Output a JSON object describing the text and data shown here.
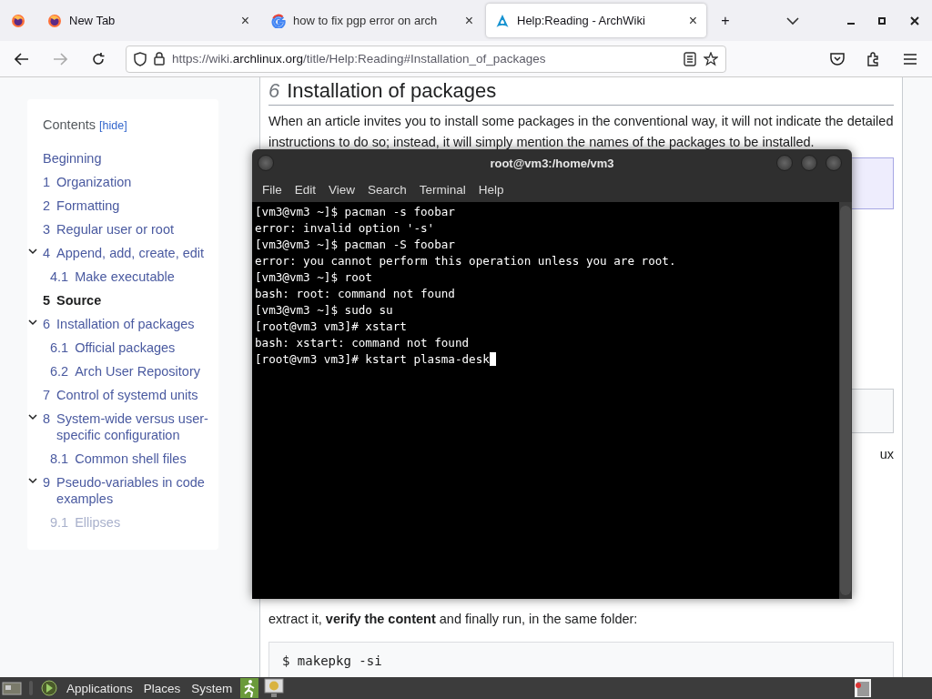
{
  "browser": {
    "tabs": [
      {
        "kind": "pinned",
        "selected": false
      },
      {
        "kind": "page",
        "label": "New Tab",
        "close": "×",
        "selected": false
      },
      {
        "kind": "page",
        "label": "how to fix pgp error on arch",
        "close": "×",
        "selected": false
      },
      {
        "kind": "page",
        "label": "Help:Reading - ArchWiki",
        "close": "×",
        "selected": true
      }
    ],
    "new_tab": "+",
    "url": {
      "scheme": "https://wiki.",
      "domain": "archlinux.org",
      "path": "/title/Help:Reading#Installation_of_packages"
    }
  },
  "toc": {
    "title": "Contents",
    "toggle": "[hide]",
    "items": [
      {
        "label": "Beginning",
        "selected": false
      },
      {
        "number": "1",
        "label": "Organization",
        "selected": false
      },
      {
        "number": "2",
        "label": "Formatting",
        "selected": false
      },
      {
        "number": "3",
        "label": "Regular user or root",
        "selected": false
      },
      {
        "number": "4",
        "label": "Append, add, create, edit",
        "selected": false,
        "expanded": true,
        "children": [
          {
            "number": "4.1",
            "label": "Make executable",
            "selected": false
          }
        ]
      },
      {
        "number": "5",
        "label": "Source",
        "selected": true
      },
      {
        "number": "6",
        "label": "Installation of packages",
        "selected": false,
        "expanded": true,
        "children": [
          {
            "number": "6.1",
            "label": "Official packages",
            "selected": false
          },
          {
            "number": "6.2",
            "label": "Arch User Repository",
            "selected": false
          }
        ]
      },
      {
        "number": "7",
        "label": "Control of systemd units",
        "selected": false
      },
      {
        "number": "8",
        "label": "System-wide versus user-specific configuration",
        "selected": false,
        "expanded": true,
        "children": [
          {
            "number": "8.1",
            "label": "Common shell files",
            "selected": false
          }
        ]
      },
      {
        "number": "9",
        "label": "Pseudo-variables in code examples",
        "selected": false,
        "expanded": true,
        "children": [
          {
            "number": "9.1",
            "label": "Ellipses",
            "selected": false
          }
        ]
      }
    ]
  },
  "article": {
    "heading_number": "6",
    "heading": "Installation of packages",
    "intro": "When an article invites you to install some packages in the conventional way, it will not indicate the detailed instructions to do so; instead, it will simply mention the names of the packages to be installed.",
    "fragment": "ux",
    "after": "extract it, **verify the content** and finally run, in the same folder:",
    "code": "$ makepkg -si"
  },
  "terminal": {
    "title": "root@vm3:/home/vm3",
    "menu": [
      "File",
      "Edit",
      "View",
      "Search",
      "Terminal",
      "Help"
    ],
    "lines": [
      "[vm3@vm3 ~]$ pacman -s foobar",
      "error: invalid option '-s'",
      "[vm3@vm3 ~]$ pacman -S foobar",
      "error: you cannot perform this operation unless you are root.",
      "[vm3@vm3 ~]$ root",
      "bash: root: command not found",
      "[vm3@vm3 ~]$ sudo su",
      "[root@vm3 vm3]# xstart",
      "bash: xstart: command not found",
      "[root@vm3 vm3]# kstart plasma-desk"
    ]
  },
  "taskbar": {
    "menus": [
      "Applications",
      "Places",
      "System"
    ]
  }
}
